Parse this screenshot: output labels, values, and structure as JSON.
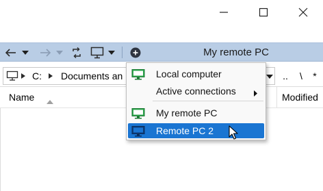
{
  "toolbar": {
    "title": "My remote PC"
  },
  "pathbar": {
    "segment_drive": "C:",
    "segment_folder": "Documents an",
    "button_dotdot": "..",
    "button_backslash": "\\",
    "button_star": "*"
  },
  "filelist": {
    "columns": [
      "Name",
      "Modified"
    ]
  },
  "menu": {
    "items": [
      {
        "label": "Local computer",
        "icon": "monitor-green-icon"
      },
      {
        "label": "Active connections",
        "icon": "",
        "submenu": true
      },
      {
        "label": "My remote PC",
        "icon": "monitor-green-icon"
      },
      {
        "label": "Remote PC 2",
        "icon": "monitor-blue-icon",
        "selected": true
      }
    ]
  },
  "colors": {
    "toolbar_bg": "#b9cde5",
    "selection": "#1a75d2",
    "monitor_green": "#2fa84f"
  }
}
